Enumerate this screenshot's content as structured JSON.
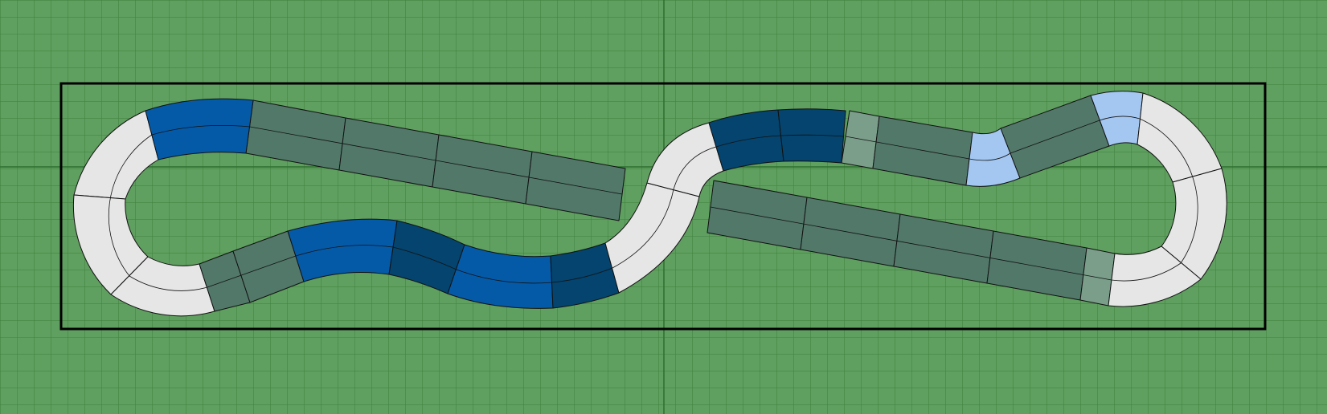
{
  "canvas": {
    "background": "#5f9f5f",
    "grid_minor_color": "#3d7f3d",
    "grid_major_color": "#2f6f2f",
    "board_border_color": "#000000"
  },
  "track_colors": {
    "straight": "#52786a",
    "short_straight": "#7a9e8a",
    "curve_white": "#e6e6e6",
    "curve_blue": "#055aa8",
    "curve_dark_blue": "#04446e",
    "curve_light_blue": "#a3c7f1"
  }
}
